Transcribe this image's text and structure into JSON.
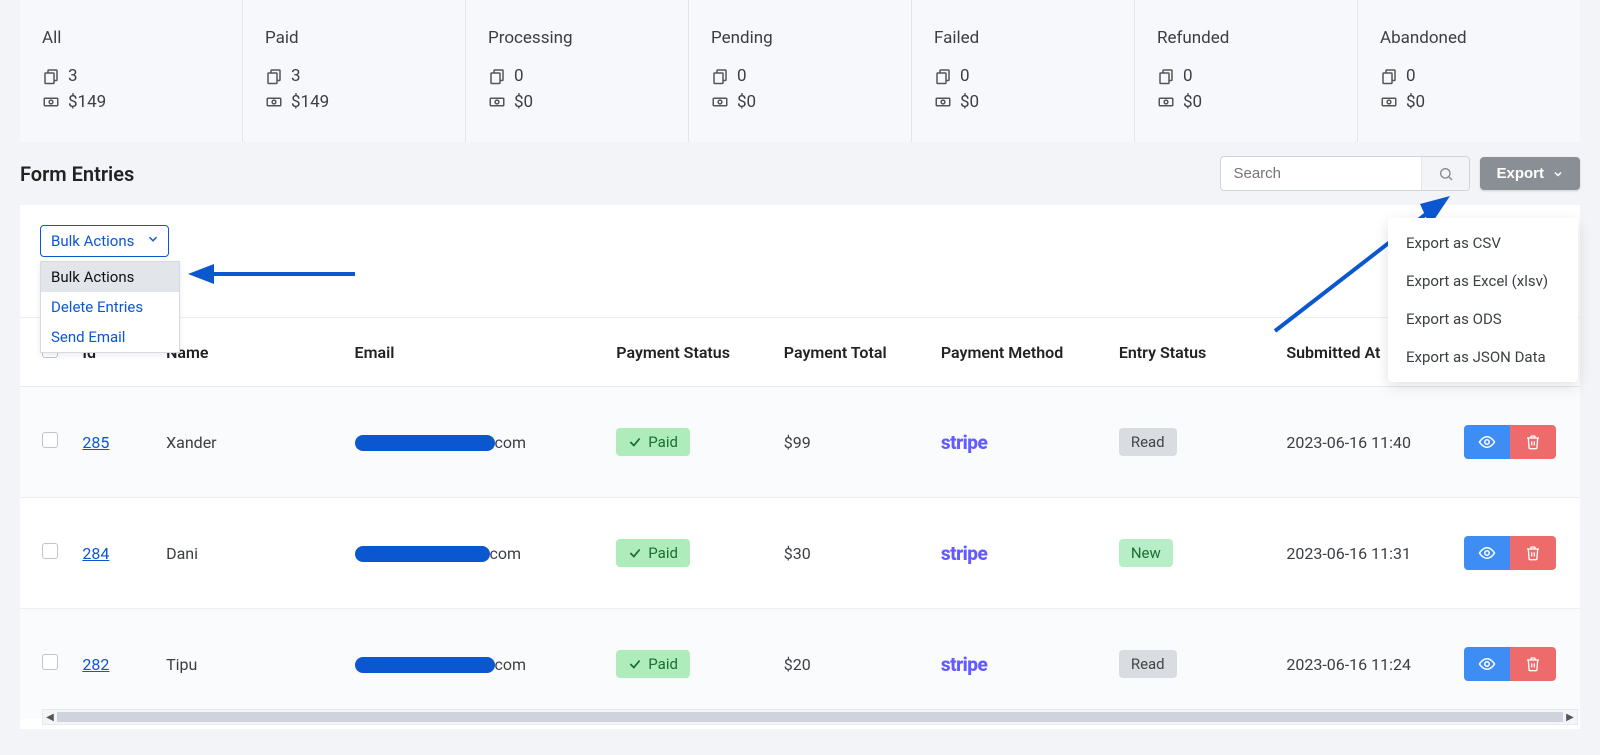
{
  "status_cards": [
    {
      "title": "All",
      "count": "3",
      "amount": "$149"
    },
    {
      "title": "Paid",
      "count": "3",
      "amount": "$149"
    },
    {
      "title": "Processing",
      "count": "0",
      "amount": "$0"
    },
    {
      "title": "Pending",
      "count": "0",
      "amount": "$0"
    },
    {
      "title": "Failed",
      "count": "0",
      "amount": "$0"
    },
    {
      "title": "Refunded",
      "count": "0",
      "amount": "$0"
    },
    {
      "title": "Abandoned",
      "count": "0",
      "amount": "$0"
    }
  ],
  "section_title": "Form Entries",
  "search": {
    "placeholder": "Search"
  },
  "export": {
    "label": "Export",
    "items": [
      "Export as CSV",
      "Export as Excel (xlsv)",
      "Export as ODS",
      "Export as JSON Data"
    ]
  },
  "bulk": {
    "label": "Bulk Actions",
    "items": [
      {
        "label": "Bulk Actions",
        "selected": true
      },
      {
        "label": "Delete Entries",
        "selected": false
      },
      {
        "label": "Send Email",
        "selected": false
      }
    ]
  },
  "columns": {
    "id": "Id",
    "name": "Name",
    "email": "Email",
    "payment_status": "Payment Status",
    "payment_total": "Payment Total",
    "payment_method": "Payment Method",
    "entry_status": "Entry Status",
    "submitted_at": "Submitted At"
  },
  "rows": [
    {
      "id": "285",
      "name": "Xander",
      "email_suffix": "com",
      "payment_status": "Paid",
      "payment_total": "$99",
      "payment_method": "stripe",
      "entry_status": "Read",
      "submitted_at": "2023-06-16 11:40"
    },
    {
      "id": "284",
      "name": "Dani",
      "email_suffix": "com",
      "payment_status": "Paid",
      "payment_total": "$30",
      "payment_method": "stripe",
      "entry_status": "New",
      "submitted_at": "2023-06-16 11:31"
    },
    {
      "id": "282",
      "name": "Tipu",
      "email_suffix": "com",
      "payment_status": "Paid",
      "payment_total": "$20",
      "payment_method": "stripe",
      "entry_status": "Read",
      "submitted_at": "2023-06-16 11:24"
    }
  ]
}
